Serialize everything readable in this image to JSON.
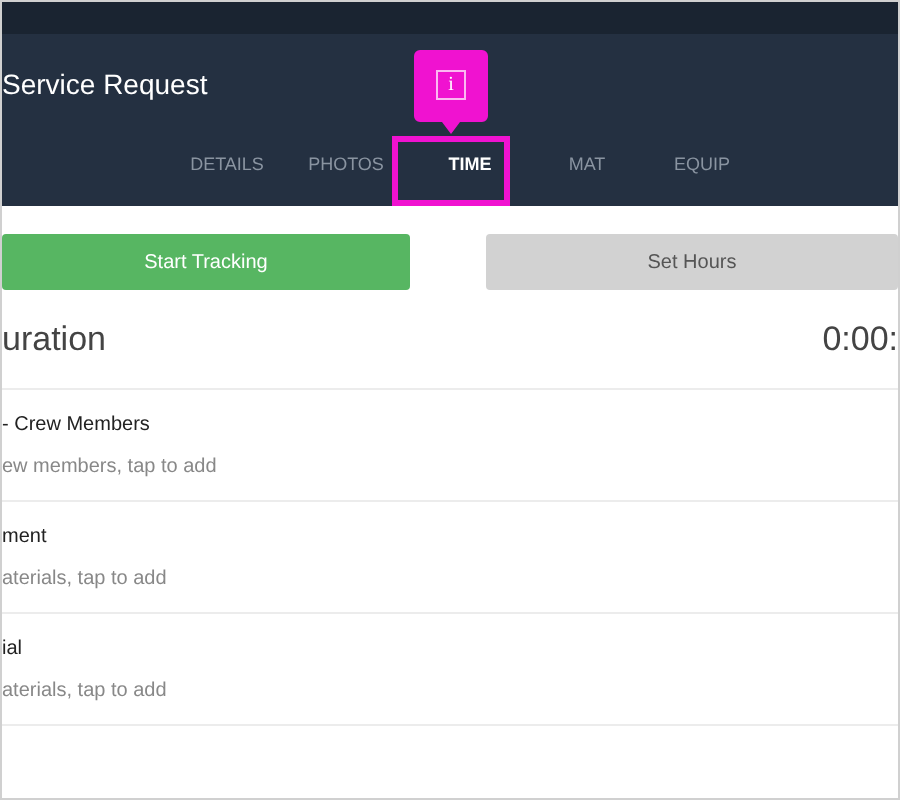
{
  "header": {
    "title": "Service Request"
  },
  "tabs": [
    {
      "label": "DETAILS",
      "selected": false
    },
    {
      "label": "PHOTOS",
      "selected": false
    },
    {
      "label": "TIME",
      "selected": true
    },
    {
      "label": "MAT",
      "selected": false
    },
    {
      "label": "EQUIP",
      "selected": false
    }
  ],
  "buttons": [
    {
      "label": "Start Tracking",
      "kind": "primary"
    },
    {
      "label": "Set Hours",
      "kind": "secondary"
    }
  ],
  "duration": {
    "label": "uration",
    "value": "0:00:"
  },
  "sections": [
    {
      "title": "- Crew Members",
      "hint": "ew members, tap to add"
    },
    {
      "title": "ment",
      "hint": "aterials, tap to add"
    },
    {
      "title": "ial",
      "hint": "aterials, tap to add"
    }
  ],
  "callout": {
    "icon_text": "i"
  }
}
